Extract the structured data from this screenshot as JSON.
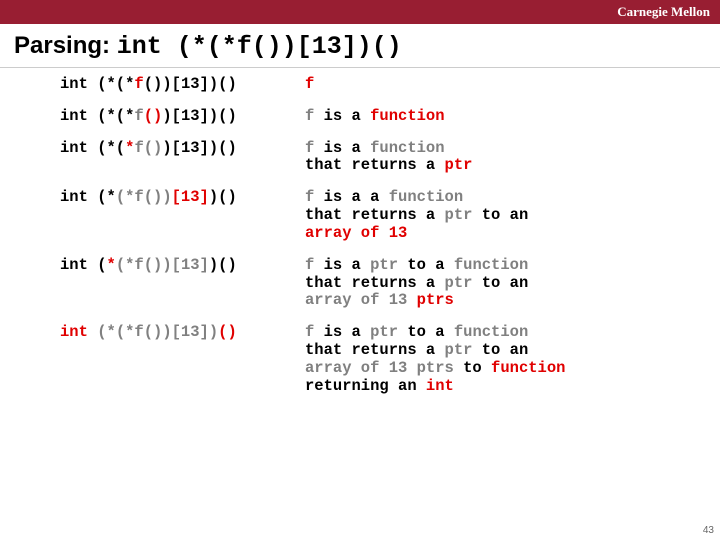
{
  "brand": "Carnegie Mellon",
  "title_prefix": "Parsing: ",
  "title_code": "int (*(*f())[13])()",
  "slide_number": "43",
  "rows": [
    {
      "lhs": "<span>int (*(*<span class='hl'>f</span>())[13])()</span>",
      "rhs": "<span class='hl'>f</span>"
    },
    {
      "lhs": "<span>int (*(*<span class='gray'>f</span><span class='hl'>()</span>)[13])()</span>",
      "rhs": "<span class='gray'>f</span> is a <span class='hl'>function</span>"
    },
    {
      "lhs": "<span>int (*(<span class='hl'>*</span><span class='gray'>f()</span>)[13])()</span>",
      "rhs": "<span class='gray'>f</span> is a <span class='gray'>function</span><br>that returns a <span class='hl'>ptr</span>"
    },
    {
      "lhs": "<span>int (*<span class='gray'>(*f())</span><span class='hl'>[13]</span>)()</span>",
      "rhs": "<span class='gray'>f</span> is a a <span class='gray'>function</span><br>that returns a <span class='gray'>ptr</span> to an<br><span class='hl'>array of 13</span>"
    },
    {
      "lhs": "<span>int (<span class='hl'>*</span><span class='gray'>(*f())[13]</span>)()</span>",
      "rhs": "<span class='gray'>f</span> is a <span class='gray'>ptr</span> to a <span class='gray'>function</span><br>that returns a <span class='gray'>ptr</span> to an<br><span class='gray'>array of 13</span> <span class='hl'>ptrs</span>"
    },
    {
      "lhs": "<span><span class='hl'>int</span> <span class='gray'>(*(*f())[13])</span><span class='hl'>()</span></span>",
      "rhs": "<span class='gray'>f</span> is a <span class='gray'>ptr</span> to a <span class='gray'>function</span><br>that returns a <span class='gray'>ptr</span> to an<br><span class='gray'>array of 13 ptrs</span> to <span class='hl'>function</span><br>returning an <span class='hl'>int</span>"
    }
  ]
}
